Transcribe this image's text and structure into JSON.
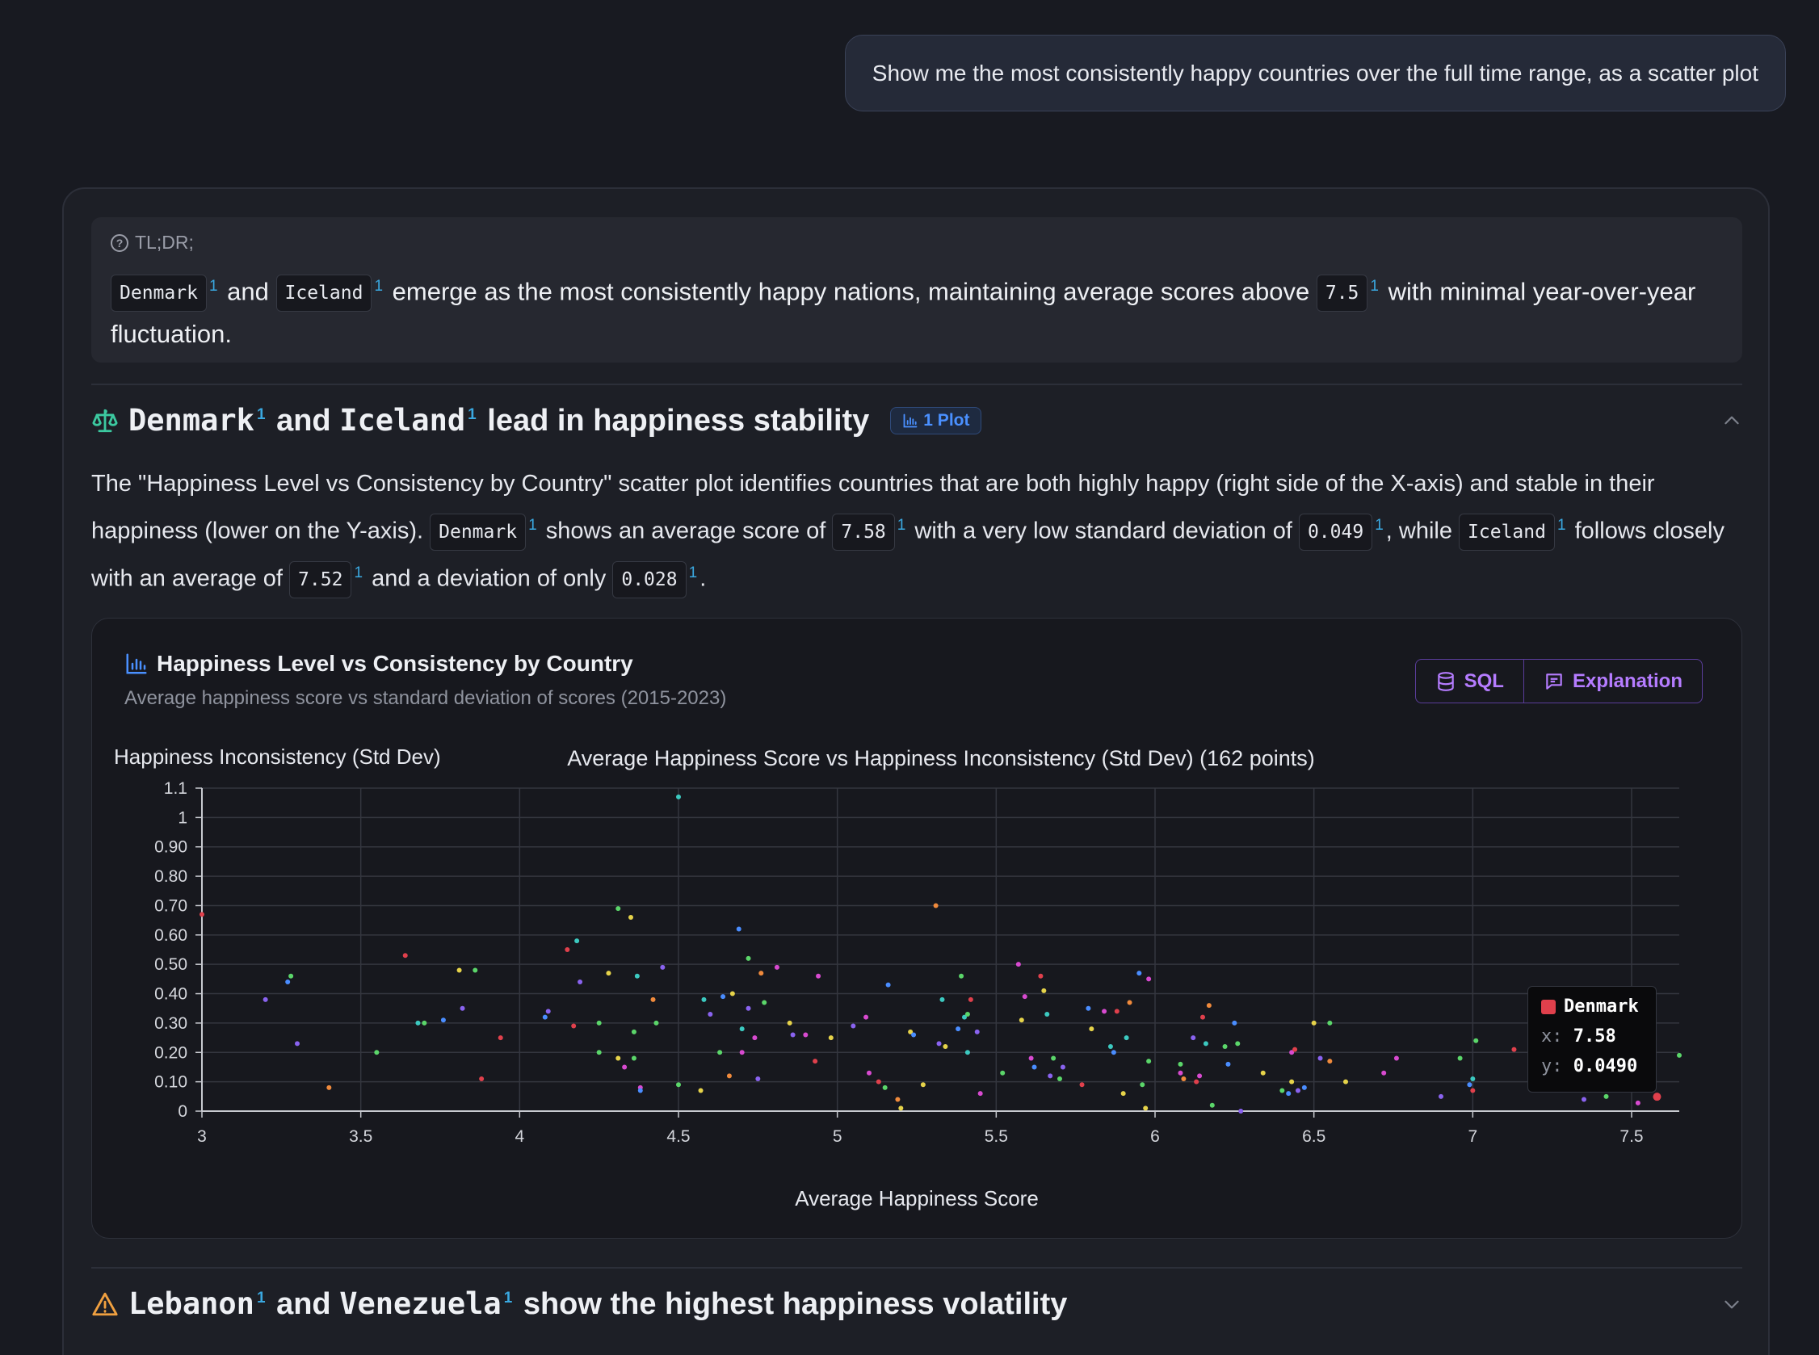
{
  "user_message": "Show me the most consistently happy countries over the full time range, as a scatter plot",
  "tldr": {
    "label": "TL;DR;",
    "country1": "Denmark",
    "and": "and",
    "country2": "Iceland",
    "text_mid": "emerge as the most consistently happy nations, maintaining average scores above",
    "threshold": "7.5",
    "text_end": "with minimal year-over-year fluctuation.",
    "cite": "1"
  },
  "section1": {
    "title_country1": "Denmark",
    "title_and": "and",
    "title_country2": "Iceland",
    "title_rest": "lead in happiness stability",
    "badge": "1 Plot",
    "icon": "scale-icon",
    "paragraph": {
      "p1": "The \"Happiness Level vs Consistency by Country\" scatter plot identifies countries that are both highly happy (right side of the X-axis) and stable in their happiness (lower on the Y-axis).",
      "denmark": "Denmark",
      "p2": "shows an average score of",
      "denmark_avg": "7.58",
      "p3": "with a very low standard deviation of",
      "denmark_sd": "0.049",
      "p4": ", while",
      "iceland": "Iceland",
      "p5": "follows closely with an average of",
      "iceland_avg": "7.52",
      "p6": "and a deviation of only",
      "iceland_sd": "0.028",
      "p7": "."
    }
  },
  "chart_card": {
    "title": "Happiness Level vs Consistency by Country",
    "subtitle": "Average happiness score vs standard deviation of scores (2015-2023)",
    "sql_label": "SQL",
    "explanation_label": "Explanation"
  },
  "tooltip": {
    "name": "Denmark",
    "x_label": "x:",
    "x_value": "7.58",
    "y_label": "y:",
    "y_value": "0.0490",
    "color": "#e0404c"
  },
  "section2": {
    "title_country1": "Lebanon",
    "title_and": "and",
    "title_country2": "Venezuela",
    "title_rest": "show the highest happiness volatility",
    "icon": "warning-icon"
  },
  "chart_data": {
    "type": "scatter",
    "title": "Average Happiness Score vs Happiness Inconsistency (Std Dev) (162 points)",
    "xlabel": "Average Happiness Score",
    "ylabel": "Happiness Inconsistency (Std Dev)",
    "xlim": [
      3,
      7.65
    ],
    "ylim": [
      0,
      1.1
    ],
    "x_ticks": [
      "3",
      "3.5",
      "4",
      "4.5",
      "5",
      "5.5",
      "6",
      "6.5",
      "7",
      "7.5"
    ],
    "x_tick_values": [
      3,
      3.5,
      4,
      4.5,
      5,
      5.5,
      6,
      6.5,
      7,
      7.5
    ],
    "y_ticks": [
      "0",
      "0.10",
      "0.20",
      "0.30",
      "0.40",
      "0.50",
      "0.60",
      "0.70",
      "0.80",
      "0.90",
      "1",
      "1.1"
    ],
    "y_tick_values": [
      0,
      0.1,
      0.2,
      0.3,
      0.4,
      0.5,
      0.6,
      0.7,
      0.8,
      0.9,
      1.0,
      1.1
    ],
    "grid": true,
    "palette": [
      "#e0404c",
      "#f08a3c",
      "#e6d34a",
      "#5bd66a",
      "#3cc9c0",
      "#4a8dff",
      "#8a63f0",
      "#d84ad0"
    ],
    "points": [
      {
        "x": 3.0,
        "y": 0.67,
        "c": 0
      },
      {
        "x": 3.2,
        "y": 0.38,
        "c": 6
      },
      {
        "x": 3.27,
        "y": 0.44,
        "c": 5
      },
      {
        "x": 3.28,
        "y": 0.46,
        "c": 3
      },
      {
        "x": 3.3,
        "y": 0.23,
        "c": 6
      },
      {
        "x": 3.4,
        "y": 0.08,
        "c": 1
      },
      {
        "x": 3.55,
        "y": 0.2,
        "c": 3
      },
      {
        "x": 3.64,
        "y": 0.53,
        "c": 0
      },
      {
        "x": 3.68,
        "y": 0.3,
        "c": 4
      },
      {
        "x": 3.7,
        "y": 0.3,
        "c": 3
      },
      {
        "x": 3.76,
        "y": 0.31,
        "c": 5
      },
      {
        "x": 3.81,
        "y": 0.48,
        "c": 2
      },
      {
        "x": 3.82,
        "y": 0.35,
        "c": 6
      },
      {
        "x": 3.86,
        "y": 0.48,
        "c": 3
      },
      {
        "x": 3.88,
        "y": 0.11,
        "c": 0
      },
      {
        "x": 3.94,
        "y": 0.25,
        "c": 0
      },
      {
        "x": 4.08,
        "y": 0.32,
        "c": 5
      },
      {
        "x": 4.09,
        "y": 0.34,
        "c": 6
      },
      {
        "x": 4.15,
        "y": 0.55,
        "c": 0
      },
      {
        "x": 4.17,
        "y": 0.29,
        "c": 0
      },
      {
        "x": 4.18,
        "y": 0.58,
        "c": 4
      },
      {
        "x": 4.19,
        "y": 0.44,
        "c": 6
      },
      {
        "x": 4.25,
        "y": 0.3,
        "c": 3
      },
      {
        "x": 4.25,
        "y": 0.2,
        "c": 3
      },
      {
        "x": 4.28,
        "y": 0.47,
        "c": 2
      },
      {
        "x": 4.31,
        "y": 0.69,
        "c": 3
      },
      {
        "x": 4.31,
        "y": 0.18,
        "c": 2
      },
      {
        "x": 4.33,
        "y": 0.15,
        "c": 7
      },
      {
        "x": 4.35,
        "y": 0.66,
        "c": 2
      },
      {
        "x": 4.36,
        "y": 0.27,
        "c": 3
      },
      {
        "x": 4.36,
        "y": 0.18,
        "c": 3
      },
      {
        "x": 4.37,
        "y": 0.46,
        "c": 4
      },
      {
        "x": 4.38,
        "y": 0.08,
        "c": 7
      },
      {
        "x": 4.38,
        "y": 0.07,
        "c": 5
      },
      {
        "x": 4.42,
        "y": 0.38,
        "c": 1
      },
      {
        "x": 4.43,
        "y": 0.3,
        "c": 3
      },
      {
        "x": 4.45,
        "y": 0.49,
        "c": 6
      },
      {
        "x": 4.5,
        "y": 1.07,
        "c": 4
      },
      {
        "x": 4.5,
        "y": 0.09,
        "c": 3
      },
      {
        "x": 4.57,
        "y": 0.07,
        "c": 2
      },
      {
        "x": 4.58,
        "y": 0.38,
        "c": 4
      },
      {
        "x": 4.6,
        "y": 0.33,
        "c": 6
      },
      {
        "x": 4.63,
        "y": 0.2,
        "c": 3
      },
      {
        "x": 4.64,
        "y": 0.39,
        "c": 5
      },
      {
        "x": 4.66,
        "y": 0.12,
        "c": 1
      },
      {
        "x": 4.67,
        "y": 0.4,
        "c": 2
      },
      {
        "x": 4.69,
        "y": 0.62,
        "c": 5
      },
      {
        "x": 4.7,
        "y": 0.28,
        "c": 4
      },
      {
        "x": 4.7,
        "y": 0.2,
        "c": 7
      },
      {
        "x": 4.72,
        "y": 0.52,
        "c": 3
      },
      {
        "x": 4.72,
        "y": 0.35,
        "c": 6
      },
      {
        "x": 4.74,
        "y": 0.25,
        "c": 7
      },
      {
        "x": 4.75,
        "y": 0.11,
        "c": 6
      },
      {
        "x": 4.76,
        "y": 0.47,
        "c": 1
      },
      {
        "x": 4.77,
        "y": 0.37,
        "c": 3
      },
      {
        "x": 4.81,
        "y": 0.49,
        "c": 7
      },
      {
        "x": 4.85,
        "y": 0.3,
        "c": 2
      },
      {
        "x": 4.86,
        "y": 0.26,
        "c": 6
      },
      {
        "x": 4.9,
        "y": 0.26,
        "c": 7
      },
      {
        "x": 4.93,
        "y": 0.17,
        "c": 0
      },
      {
        "x": 4.94,
        "y": 0.46,
        "c": 7
      },
      {
        "x": 4.98,
        "y": 0.25,
        "c": 2
      },
      {
        "x": 5.05,
        "y": 0.29,
        "c": 6
      },
      {
        "x": 5.09,
        "y": 0.32,
        "c": 7
      },
      {
        "x": 5.1,
        "y": 0.13,
        "c": 7
      },
      {
        "x": 5.13,
        "y": 0.1,
        "c": 0
      },
      {
        "x": 5.15,
        "y": 0.08,
        "c": 3
      },
      {
        "x": 5.16,
        "y": 0.43,
        "c": 5
      },
      {
        "x": 5.19,
        "y": 0.04,
        "c": 1
      },
      {
        "x": 5.2,
        "y": 0.01,
        "c": 2
      },
      {
        "x": 5.23,
        "y": 0.27,
        "c": 2
      },
      {
        "x": 5.24,
        "y": 0.26,
        "c": 5
      },
      {
        "x": 5.27,
        "y": 0.09,
        "c": 2
      },
      {
        "x": 5.31,
        "y": 0.7,
        "c": 1
      },
      {
        "x": 5.32,
        "y": 0.23,
        "c": 6
      },
      {
        "x": 5.33,
        "y": 0.38,
        "c": 4
      },
      {
        "x": 5.34,
        "y": 0.22,
        "c": 2
      },
      {
        "x": 5.38,
        "y": 0.28,
        "c": 5
      },
      {
        "x": 5.39,
        "y": 0.46,
        "c": 3
      },
      {
        "x": 5.4,
        "y": 0.32,
        "c": 4
      },
      {
        "x": 5.41,
        "y": 0.33,
        "c": 3
      },
      {
        "x": 5.41,
        "y": 0.2,
        "c": 4
      },
      {
        "x": 5.42,
        "y": 0.38,
        "c": 0
      },
      {
        "x": 5.44,
        "y": 0.27,
        "c": 6
      },
      {
        "x": 5.45,
        "y": 0.06,
        "c": 7
      },
      {
        "x": 5.52,
        "y": 0.13,
        "c": 3
      },
      {
        "x": 5.57,
        "y": 0.5,
        "c": 7
      },
      {
        "x": 5.58,
        "y": 0.31,
        "c": 2
      },
      {
        "x": 5.59,
        "y": 0.39,
        "c": 7
      },
      {
        "x": 5.61,
        "y": 0.18,
        "c": 7
      },
      {
        "x": 5.62,
        "y": 0.15,
        "c": 5
      },
      {
        "x": 5.64,
        "y": 0.46,
        "c": 0
      },
      {
        "x": 5.65,
        "y": 0.41,
        "c": 2
      },
      {
        "x": 5.66,
        "y": 0.33,
        "c": 4
      },
      {
        "x": 5.67,
        "y": 0.12,
        "c": 6
      },
      {
        "x": 5.68,
        "y": 0.18,
        "c": 3
      },
      {
        "x": 5.7,
        "y": 0.11,
        "c": 3
      },
      {
        "x": 5.71,
        "y": 0.15,
        "c": 6
      },
      {
        "x": 5.77,
        "y": 0.09,
        "c": 0
      },
      {
        "x": 5.79,
        "y": 0.35,
        "c": 5
      },
      {
        "x": 5.8,
        "y": 0.28,
        "c": 2
      },
      {
        "x": 5.84,
        "y": 0.34,
        "c": 7
      },
      {
        "x": 5.86,
        "y": 0.22,
        "c": 4
      },
      {
        "x": 5.87,
        "y": 0.2,
        "c": 5
      },
      {
        "x": 5.88,
        "y": 0.34,
        "c": 0
      },
      {
        "x": 5.9,
        "y": 0.06,
        "c": 2
      },
      {
        "x": 5.91,
        "y": 0.25,
        "c": 4
      },
      {
        "x": 5.92,
        "y": 0.37,
        "c": 1
      },
      {
        "x": 5.95,
        "y": 0.47,
        "c": 5
      },
      {
        "x": 5.96,
        "y": 0.09,
        "c": 3
      },
      {
        "x": 5.97,
        "y": 0.01,
        "c": 2
      },
      {
        "x": 5.98,
        "y": 0.45,
        "c": 7
      },
      {
        "x": 5.98,
        "y": 0.17,
        "c": 3
      },
      {
        "x": 6.08,
        "y": 0.16,
        "c": 3
      },
      {
        "x": 6.08,
        "y": 0.13,
        "c": 7
      },
      {
        "x": 6.09,
        "y": 0.11,
        "c": 1
      },
      {
        "x": 6.12,
        "y": 0.25,
        "c": 6
      },
      {
        "x": 6.13,
        "y": 0.1,
        "c": 0
      },
      {
        "x": 6.14,
        "y": 0.12,
        "c": 7
      },
      {
        "x": 6.15,
        "y": 0.32,
        "c": 0
      },
      {
        "x": 6.16,
        "y": 0.23,
        "c": 4
      },
      {
        "x": 6.17,
        "y": 0.36,
        "c": 1
      },
      {
        "x": 6.18,
        "y": 0.02,
        "c": 3
      },
      {
        "x": 6.22,
        "y": 0.22,
        "c": 3
      },
      {
        "x": 6.23,
        "y": 0.16,
        "c": 5
      },
      {
        "x": 6.25,
        "y": 0.3,
        "c": 5
      },
      {
        "x": 6.26,
        "y": 0.23,
        "c": 3
      },
      {
        "x": 6.27,
        "y": 0.0,
        "c": 6
      },
      {
        "x": 6.34,
        "y": 0.13,
        "c": 2
      },
      {
        "x": 6.4,
        "y": 0.07,
        "c": 3
      },
      {
        "x": 6.42,
        "y": 0.06,
        "c": 5
      },
      {
        "x": 6.43,
        "y": 0.1,
        "c": 2
      },
      {
        "x": 6.43,
        "y": 0.2,
        "c": 7
      },
      {
        "x": 6.44,
        "y": 0.21,
        "c": 0
      },
      {
        "x": 6.45,
        "y": 0.07,
        "c": 6
      },
      {
        "x": 6.47,
        "y": 0.08,
        "c": 5
      },
      {
        "x": 6.5,
        "y": 0.3,
        "c": 2
      },
      {
        "x": 6.52,
        "y": 0.18,
        "c": 6
      },
      {
        "x": 6.55,
        "y": 0.17,
        "c": 1
      },
      {
        "x": 6.55,
        "y": 0.3,
        "c": 3
      },
      {
        "x": 6.6,
        "y": 0.1,
        "c": 2
      },
      {
        "x": 6.72,
        "y": 0.13,
        "c": 7
      },
      {
        "x": 6.76,
        "y": 0.18,
        "c": 7
      },
      {
        "x": 6.9,
        "y": 0.05,
        "c": 6
      },
      {
        "x": 6.96,
        "y": 0.18,
        "c": 3
      },
      {
        "x": 6.99,
        "y": 0.09,
        "c": 5
      },
      {
        "x": 7.0,
        "y": 0.11,
        "c": 4
      },
      {
        "x": 7.0,
        "y": 0.07,
        "c": 0
      },
      {
        "x": 7.01,
        "y": 0.24,
        "c": 3
      },
      {
        "x": 7.13,
        "y": 0.21,
        "c": 0
      },
      {
        "x": 7.35,
        "y": 0.04,
        "c": 6
      },
      {
        "x": 7.42,
        "y": 0.05,
        "c": 3
      },
      {
        "x": 7.52,
        "y": 0.028,
        "c": 7
      },
      {
        "x": 7.58,
        "y": 0.049,
        "c": 0,
        "highlight": true
      },
      {
        "x": 7.65,
        "y": 0.19,
        "c": 3
      }
    ]
  }
}
